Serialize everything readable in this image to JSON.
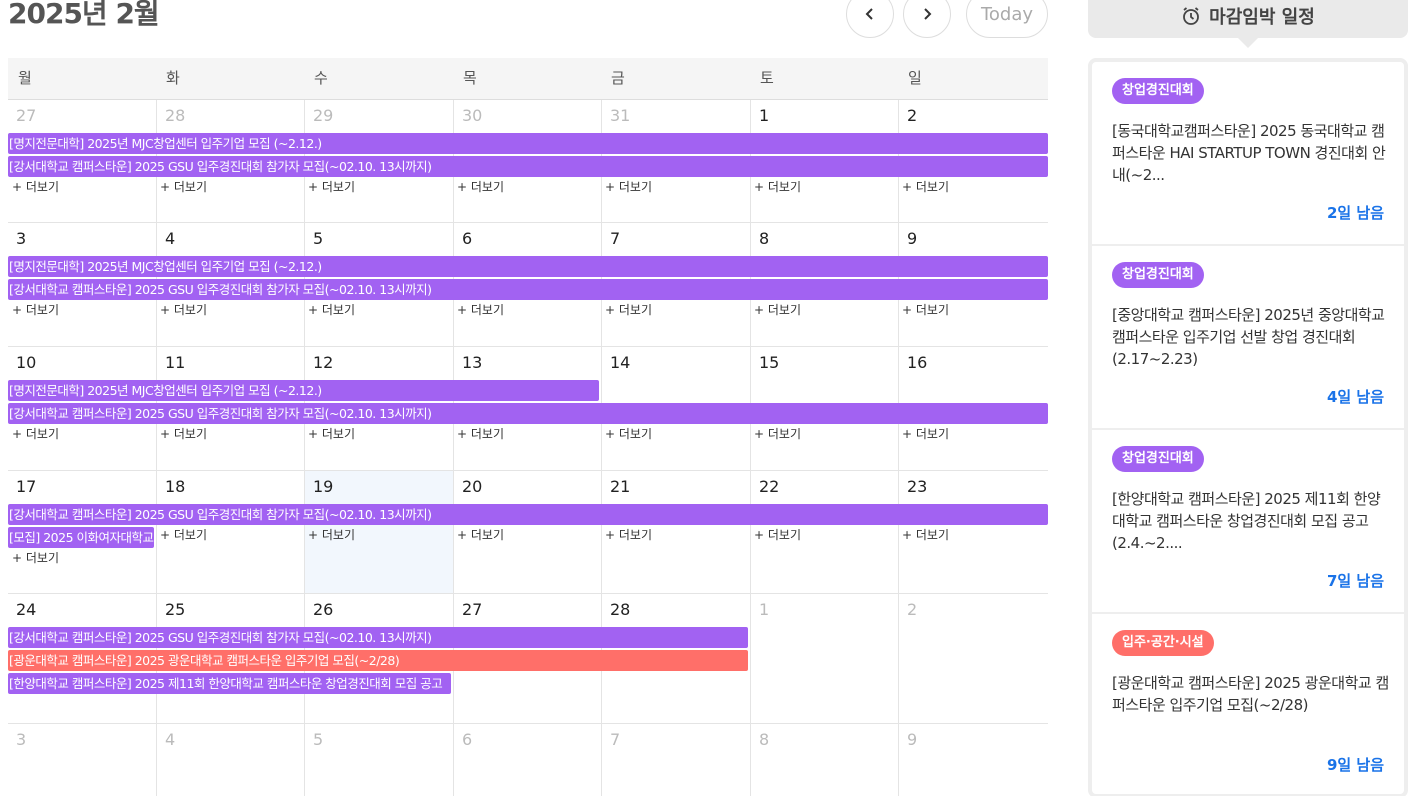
{
  "header": {
    "title": "2025년 2월",
    "today_label": "Today"
  },
  "weekdays": [
    "월",
    "화",
    "수",
    "목",
    "금",
    "토",
    "일"
  ],
  "more_label": "+ 더보기",
  "weeks": [
    {
      "days": [
        {
          "n": "27",
          "other": true
        },
        {
          "n": "28",
          "other": true
        },
        {
          "n": "29",
          "other": true
        },
        {
          "n": "30",
          "other": true
        },
        {
          "n": "31",
          "other": true
        },
        {
          "n": "1"
        },
        {
          "n": "2"
        }
      ],
      "events": [
        {
          "title": "[명지전문대학] 2025년 MJC창업센터 입주기업 모집 (~2.12.)",
          "color": "purple",
          "start": 0,
          "span": 7,
          "lane": 0
        },
        {
          "title": "[강서대학교 캠퍼스타운] 2025 GSU 입주경진대회 참가자 모집(~02.10. 13시까지)",
          "color": "purple",
          "start": 0,
          "span": 7,
          "lane": 1
        }
      ],
      "more": [
        0,
        1,
        2,
        3,
        4,
        5,
        6
      ],
      "more_lane": 2,
      "height": 123
    },
    {
      "days": [
        {
          "n": "3"
        },
        {
          "n": "4"
        },
        {
          "n": "5"
        },
        {
          "n": "6"
        },
        {
          "n": "7"
        },
        {
          "n": "8"
        },
        {
          "n": "9"
        }
      ],
      "events": [
        {
          "title": "[명지전문대학] 2025년 MJC창업센터 입주기업 모집 (~2.12.)",
          "color": "purple",
          "start": 0,
          "span": 7,
          "lane": 0
        },
        {
          "title": "[강서대학교 캠퍼스타운] 2025 GSU 입주경진대회 참가자 모집(~02.10. 13시까지)",
          "color": "purple",
          "start": 0,
          "span": 7,
          "lane": 1
        }
      ],
      "more": [
        0,
        1,
        2,
        3,
        4,
        5,
        6
      ],
      "more_lane": 2,
      "height": 124
    },
    {
      "days": [
        {
          "n": "10"
        },
        {
          "n": "11"
        },
        {
          "n": "12"
        },
        {
          "n": "13"
        },
        {
          "n": "14"
        },
        {
          "n": "15"
        },
        {
          "n": "16"
        }
      ],
      "events": [
        {
          "title": "[명지전문대학] 2025년 MJC창업센터 입주기업 모집 (~2.12.)",
          "color": "purple",
          "start": 0,
          "span": 4,
          "lane": 0
        },
        {
          "title": "[강서대학교 캠퍼스타운] 2025 GSU 입주경진대회 참가자 모집(~02.10. 13시까지)",
          "color": "purple",
          "start": 0,
          "span": 7,
          "lane": 1
        }
      ],
      "more": [
        0,
        1,
        2,
        3,
        4,
        5,
        6
      ],
      "more_lane": 2,
      "height": 124
    },
    {
      "days": [
        {
          "n": "17"
        },
        {
          "n": "18"
        },
        {
          "n": "19",
          "today": true
        },
        {
          "n": "20"
        },
        {
          "n": "21"
        },
        {
          "n": "22"
        },
        {
          "n": "23"
        }
      ],
      "events": [
        {
          "title": "[강서대학교 캠퍼스타운] 2025 GSU 입주경진대회 참가자 모집(~02.10. 13시까지)",
          "color": "purple",
          "start": 0,
          "span": 7,
          "lane": 0
        },
        {
          "title": "[모집] 2025 이화여자대학교",
          "color": "purple",
          "start": 0,
          "span": 1,
          "lane": 1
        }
      ],
      "more": [
        1,
        2,
        3,
        4,
        5,
        6
      ],
      "more_lane": 1,
      "extra_more": [
        0
      ],
      "extra_more_lane": 2,
      "height": 123
    },
    {
      "days": [
        {
          "n": "24"
        },
        {
          "n": "25"
        },
        {
          "n": "26"
        },
        {
          "n": "27"
        },
        {
          "n": "28"
        },
        {
          "n": "1",
          "other": true
        },
        {
          "n": "2",
          "other": true
        }
      ],
      "events": [
        {
          "title": "[강서대학교 캠퍼스타운] 2025 GSU 입주경진대회 참가자 모집(~02.10. 13시까지)",
          "color": "purple",
          "start": 0,
          "span": 5,
          "lane": 0
        },
        {
          "title": "[광운대학교 캠퍼스타운] 2025 광운대학교 캠퍼스타운 입주기업 모집(~2/28)",
          "color": "red",
          "start": 0,
          "span": 5,
          "lane": 1
        },
        {
          "title": "[한양대학교 캠퍼스타운] 2025 제11회 한양대학교 캠퍼스타운 창업경진대회 모집 공고",
          "color": "purple",
          "start": 0,
          "span": 3,
          "lane": 2
        }
      ],
      "more": [],
      "more_lane": 3,
      "height": 130
    },
    {
      "days": [
        {
          "n": "3",
          "other": true
        },
        {
          "n": "4",
          "other": true
        },
        {
          "n": "5",
          "other": true
        },
        {
          "n": "6",
          "other": true
        },
        {
          "n": "7",
          "other": true
        },
        {
          "n": "8",
          "other": true
        },
        {
          "n": "9",
          "other": true
        }
      ],
      "events": [],
      "more": [],
      "more_lane": 0,
      "height": 80
    }
  ],
  "sidebar": {
    "title": "마감임박 일정",
    "items": [
      {
        "category": "창업경진대회",
        "color": "purple",
        "title": "[동국대학교캠퍼스타운] 2025 동국대학교 캠퍼스타운 HAI STARTUP TOWN 경진대회 안내(~2...",
        "dday": "2일 남음"
      },
      {
        "category": "창업경진대회",
        "color": "purple",
        "title": "[중앙대학교 캠퍼스타운] 2025년 중앙대학교 캠퍼스타운 입주기업 선발 창업 경진대회(2.17~2.23)",
        "dday": "4일 남음"
      },
      {
        "category": "창업경진대회",
        "color": "purple",
        "title": "[한양대학교 캠퍼스타운] 2025 제11회 한양대학교 캠퍼스타운 창업경진대회 모집 공고(2.4.~2....",
        "dday": "7일 남음"
      },
      {
        "category": "입주·공간·시설",
        "color": "red",
        "title": "[광운대학교 캠퍼스타운] 2025 광운대학교 캠퍼스타운 입주기업 모집(~2/28)",
        "dday": "9일 남음"
      }
    ]
  }
}
